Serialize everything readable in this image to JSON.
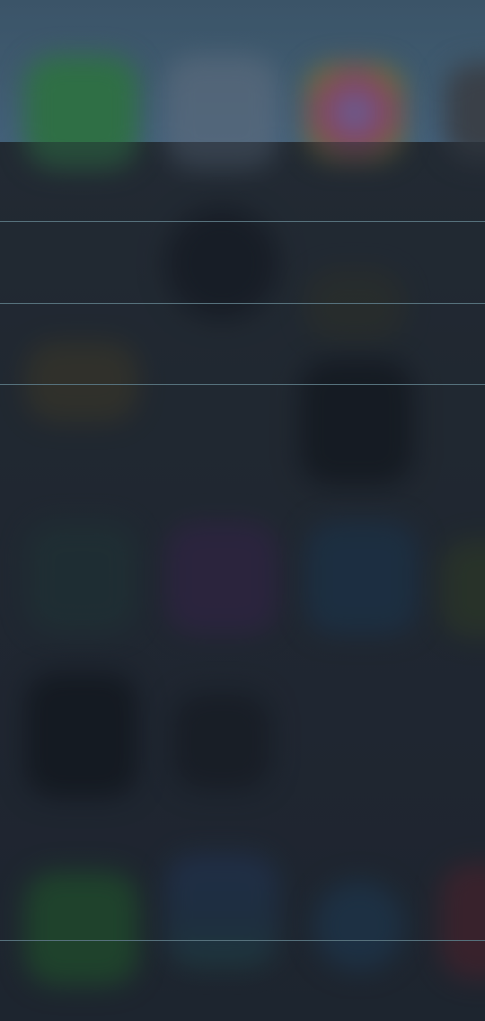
{
  "background": {
    "top_tint": "#3f5a6f",
    "sheet_tint": "#222a33",
    "divider_color": "#56717c"
  },
  "blurred_icons": [
    {
      "name": "messages-app-icon",
      "color": "#2f6f45"
    },
    {
      "name": "calendar-app-icon",
      "color": "#5a6a7c"
    },
    {
      "name": "photos-app-icon",
      "color": "#8a3f63"
    },
    {
      "name": "camera-app-icon",
      "color": "#3a4048"
    },
    {
      "name": "clock-app-icon",
      "color": "#121720"
    },
    {
      "name": "notes-app-icon",
      "color": "#5a4a1e"
    },
    {
      "name": "reminders-app-icon",
      "color": "#2a2f36"
    },
    {
      "name": "stocks-app-icon",
      "color": "#0e131a"
    },
    {
      "name": "game-center-app-icon",
      "color": "#1e3a3a"
    },
    {
      "name": "itunes-app-icon",
      "color": "#3a2350"
    },
    {
      "name": "app-store-app-icon",
      "color": "#1b3650"
    },
    {
      "name": "passbook-app-icon",
      "color": "#0c1118"
    },
    {
      "name": "compass-app-icon",
      "color": "#131820"
    },
    {
      "name": "settings-app-icon",
      "color": "#1f2a2e"
    },
    {
      "name": "phone-dock-icon",
      "color": "#1f5a2a"
    },
    {
      "name": "mail-dock-icon",
      "color": "#213a66"
    },
    {
      "name": "safari-dock-icon",
      "color": "#1c3a55"
    },
    {
      "name": "music-dock-icon",
      "color": "#5a1f2a"
    }
  ]
}
